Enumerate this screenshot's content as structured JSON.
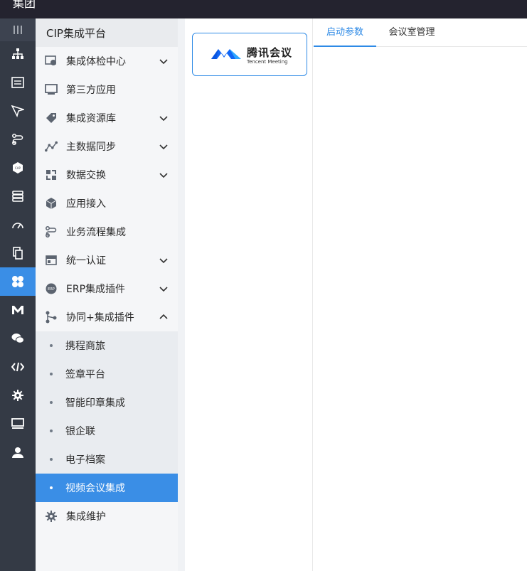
{
  "window": {
    "title": "集团"
  },
  "iconbar": {
    "items": [
      {
        "icon": "menu-lines-icon"
      },
      {
        "icon": "org-chart-icon"
      },
      {
        "icon": "list-card-icon"
      },
      {
        "icon": "send-icon"
      },
      {
        "icon": "flow-icon"
      },
      {
        "icon": "cap-hexagon-icon",
        "text": "CAP"
      },
      {
        "icon": "stack-icon"
      },
      {
        "icon": "speedometer-icon"
      },
      {
        "icon": "documents-icon"
      },
      {
        "icon": "clover-icon",
        "active": true
      },
      {
        "icon": "m-logo-icon"
      },
      {
        "icon": "wechat-icon"
      },
      {
        "icon": "code-icon"
      },
      {
        "icon": "gear-icon"
      },
      {
        "icon": "monitor-icon"
      },
      {
        "icon": "user-icon"
      }
    ]
  },
  "sidebar": {
    "title": "CIP集成平台",
    "items": [
      {
        "label": "集成体检中心",
        "icon": "health-check-icon",
        "chevron": "down"
      },
      {
        "label": "第三方应用",
        "icon": "monitor-icon",
        "chevron": ""
      },
      {
        "label": "集成资源库",
        "icon": "tag-icon",
        "chevron": "down"
      },
      {
        "label": "主数据同步",
        "icon": "line-chart-icon",
        "chevron": "down"
      },
      {
        "label": "数据交换",
        "icon": "exchange-icon",
        "chevron": "down"
      },
      {
        "label": "应用接入",
        "icon": "cube-icon",
        "chevron": ""
      },
      {
        "label": "业务流程集成",
        "icon": "flow-icon",
        "chevron": ""
      },
      {
        "label": "统一认证",
        "icon": "id-card-icon",
        "chevron": "down"
      },
      {
        "label": "ERP集成插件",
        "icon": "erp-icon",
        "icon_text": "ERP",
        "chevron": "down"
      },
      {
        "label": "协同+集成插件",
        "icon": "share-icon",
        "chevron": "up"
      }
    ],
    "subitems": [
      {
        "label": "携程商旅"
      },
      {
        "label": "签章平台"
      },
      {
        "label": "智能印章集成"
      },
      {
        "label": "银企联"
      },
      {
        "label": "电子档案"
      },
      {
        "label": "视频会议集成",
        "active": true
      }
    ],
    "last_item": {
      "label": "集成维护",
      "icon": "gear-icon"
    }
  },
  "app_card": {
    "name_cn": "腾讯会议",
    "name_en": "Tencent Meeting",
    "icon": "tencent-meeting-logo-icon"
  },
  "tabs": [
    {
      "label": "启动参数",
      "active": true
    },
    {
      "label": "会议室管理",
      "active": false
    }
  ],
  "colors": {
    "accent": "#2e8ae6",
    "iconbar_bg": "#343a45",
    "topbar_bg": "#24232f",
    "sidebar_bg": "#f5f6f8"
  }
}
